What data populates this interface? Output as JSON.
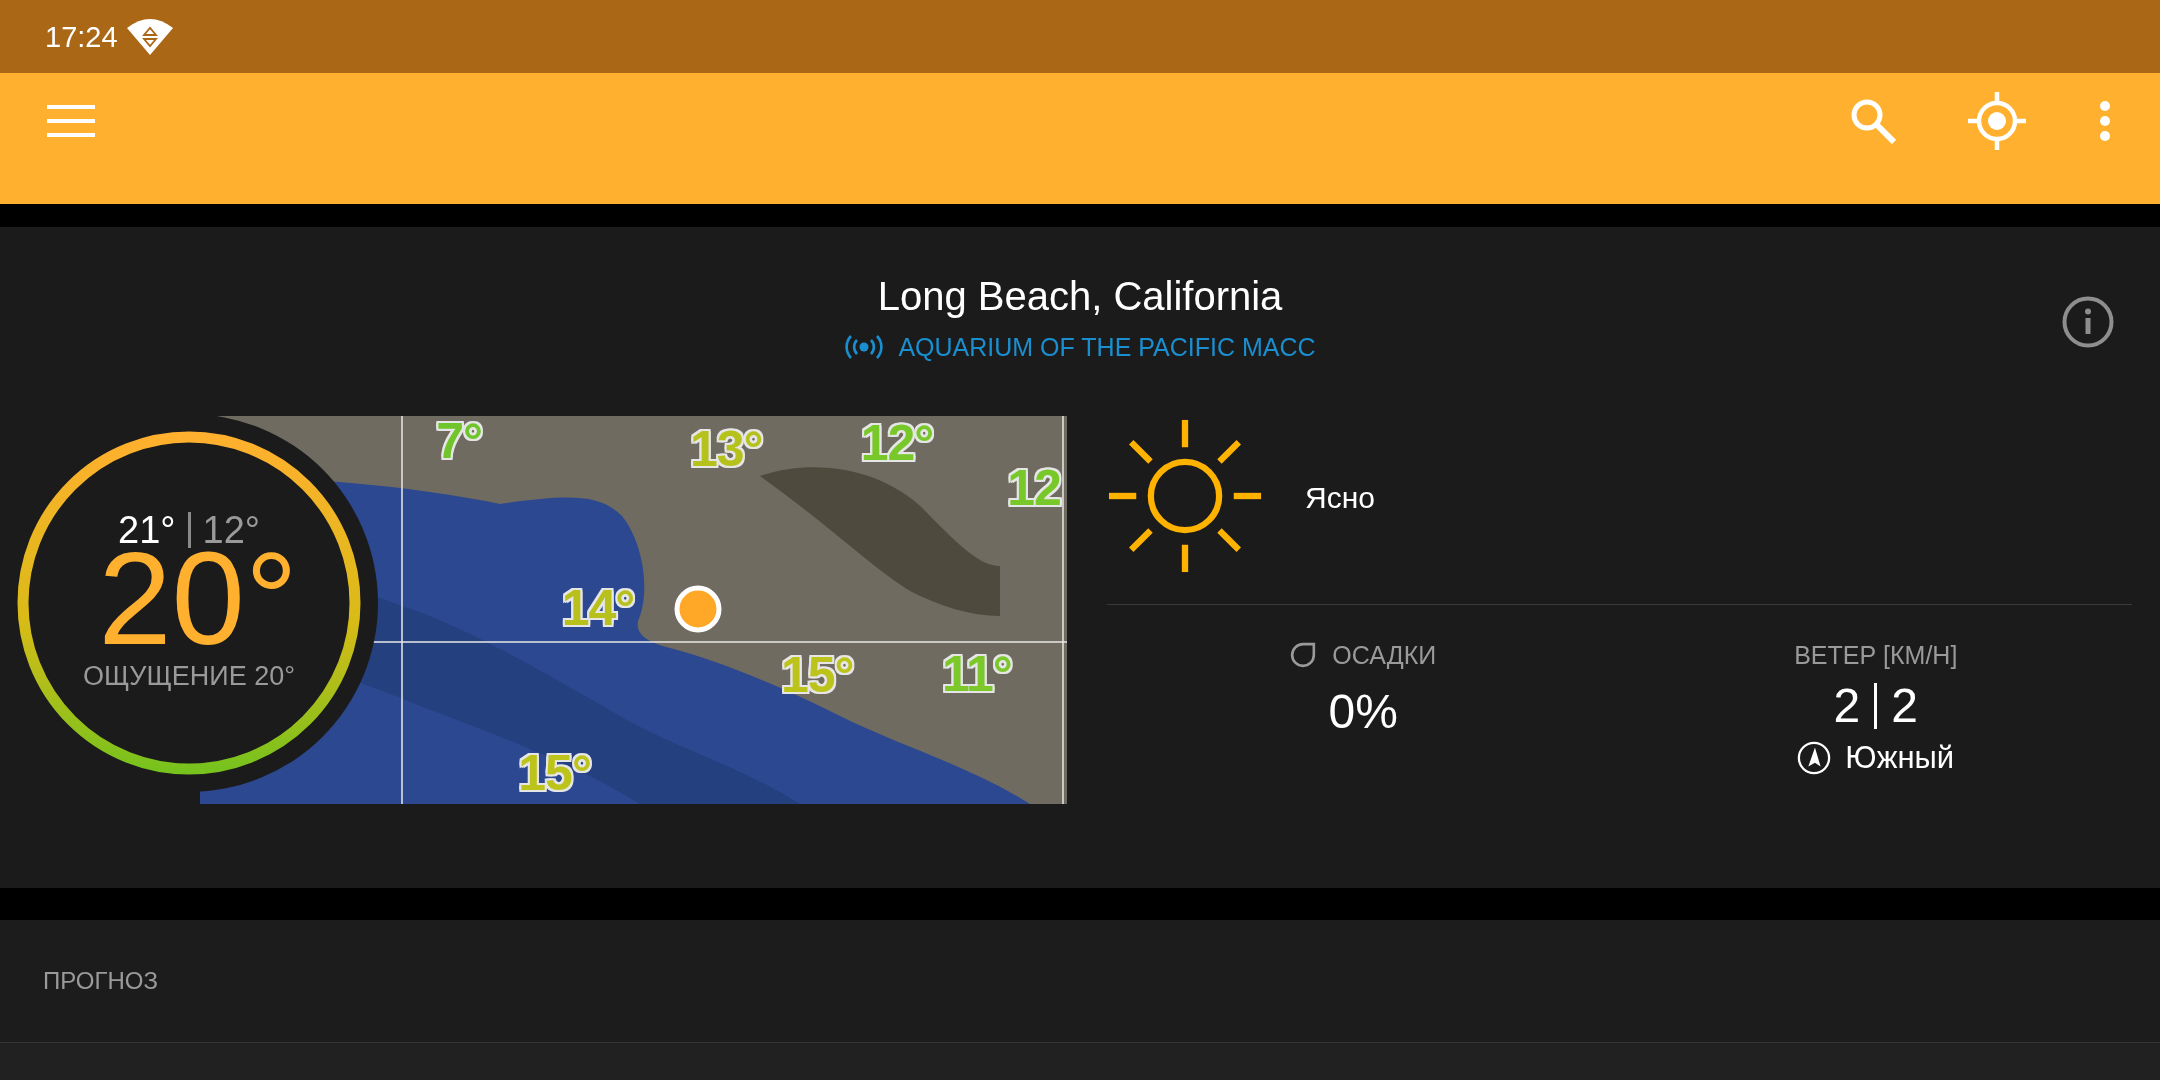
{
  "status_bar": {
    "time": "17:24"
  },
  "location": {
    "name": "Long Beach, California",
    "station": "AQUARIUM OF THE PACIFIC MACC"
  },
  "current": {
    "high": "21°",
    "low": "12°",
    "temperature": "20°",
    "feels_like": "ОЩУЩЕНИЕ 20°",
    "condition": "Ясно"
  },
  "map": {
    "labels": [
      {
        "text": "7°",
        "color": "#6fc52a"
      },
      {
        "text": "13°",
        "color": "#b5c21c"
      },
      {
        "text": "12°",
        "color": "#78c82a"
      },
      {
        "text": "12",
        "color": "#78c82a"
      },
      {
        "text": "14°",
        "color": "#b8c11c"
      },
      {
        "text": "15°",
        "color": "#bcc31a"
      },
      {
        "text": "11°",
        "color": "#7cc72a"
      },
      {
        "text": "15°",
        "color": "#bcc31a"
      }
    ]
  },
  "precipitation": {
    "label": "ОСАДКИ",
    "value": "0%"
  },
  "wind": {
    "label": "ВЕТЕР [КМ/Н]",
    "speed": "2",
    "gust": "2",
    "direction": "Южный"
  },
  "forecast": {
    "title": "ПРОГНОЗ"
  }
}
